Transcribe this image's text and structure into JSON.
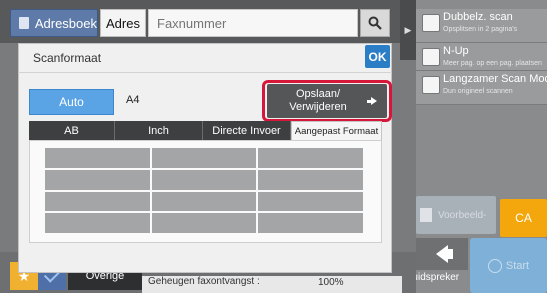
{
  "header": {
    "adresboek_label": "Adresboek",
    "adres_label": "Adres",
    "fax_placeholder": "Faxnummer"
  },
  "dialog": {
    "title": "Scanformaat",
    "ok_label": "OK",
    "auto_label": "Auto",
    "size_value": "A4",
    "save_label_line1": "Opslaan/",
    "save_label_line2": "Verwijderen",
    "tabs": [
      {
        "label": "AB",
        "active": false
      },
      {
        "label": "Inch",
        "active": false
      },
      {
        "label": "Directe Invoer",
        "active": false
      },
      {
        "label": "Aangepast Formaat",
        "active": true
      }
    ],
    "custom_slots_count": 12
  },
  "options": [
    {
      "title": "Dubbelz. scan",
      "sub": "Opsplitsen in 2 pagina's"
    },
    {
      "title": "N-Up",
      "sub": "Meer pag. op een pag. plaatsen"
    },
    {
      "title": "Langzamer Scan Mode.",
      "sub": "Dun origineel scannen"
    }
  ],
  "actions": {
    "preview_label": "Voorbeeld-",
    "ca_label": "CA",
    "speaker_label": "Luidspreker",
    "start_label": "Start"
  },
  "bottom": {
    "overige_label": "Overige",
    "status_text": "Geheugen faxontvangst :",
    "status_value": "100%"
  },
  "colors": {
    "accent_blue": "#2b7dc6",
    "highlight_red": "#d6173a",
    "ca_orange": "#f4a70c",
    "start_blue": "#7fb1d8"
  },
  "icons": [
    "address-book-icon",
    "search-icon",
    "chevron-right-icon",
    "checkbox-icon",
    "preview-icon",
    "speaker-icon",
    "start-icon",
    "star-icon",
    "check-icon",
    "arrow-right-icon"
  ]
}
